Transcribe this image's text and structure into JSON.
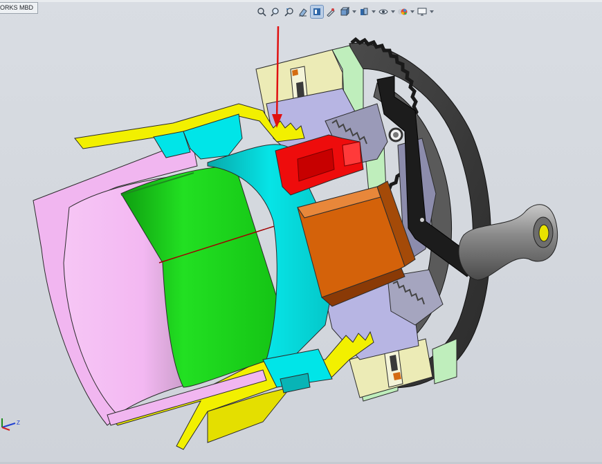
{
  "tab": {
    "label": "ORKS MBD"
  },
  "toolbar": {
    "tools": [
      {
        "name": "zoom-to-fit-icon"
      },
      {
        "name": "zoom-to-area-icon"
      },
      {
        "name": "previous-view-icon"
      },
      {
        "name": "section-view-icon"
      },
      {
        "name": "dynamic-annotation-view-icon"
      },
      {
        "name": "view-orientation-icon"
      },
      {
        "name": "display-style-icon"
      },
      {
        "name": "hide-show-items-icon"
      },
      {
        "name": "edit-appearance-icon"
      },
      {
        "name": "apply-scene-icon"
      },
      {
        "name": "view-settings-icon"
      }
    ]
  },
  "triad": {
    "z_label": "Z"
  },
  "colors": {
    "viewport_bg": "#d4d8de",
    "pink_shell": "#f1b6f0",
    "green_part": "#1ed81e",
    "cyan_part": "#00e5e8",
    "yellow_part": "#f2f000",
    "red_part": "#ee0c0c",
    "orange_part": "#d4620a",
    "lavender_part": "#b7b5e3",
    "mint_part": "#bfeebc",
    "cream_part": "#ecebb6",
    "dark_gear": "#3a3a3a",
    "annotation_arrow": "#e01010"
  }
}
